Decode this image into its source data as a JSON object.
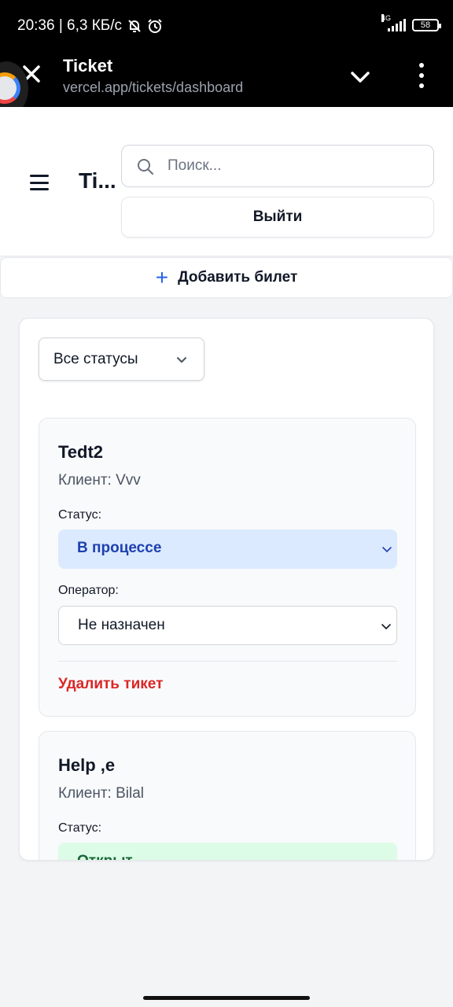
{
  "status_bar": {
    "time_speed": "20:36 | 6,3 КБ/с",
    "network": "4G",
    "battery": "58"
  },
  "browser": {
    "title": "Ticket",
    "url": "vercel.app/tickets/dashboard",
    "icons": [
      "close-icon",
      "chevron-down-icon",
      "more-vert-icon"
    ]
  },
  "header": {
    "app_title": "Ti...",
    "search_placeholder": "Поиск...",
    "logout_label": "Выйти"
  },
  "toolbar": {
    "add_ticket_label": "Добавить билет"
  },
  "filter": {
    "selected": "Все статусы"
  },
  "colors": {
    "in_progress_bg": "#dbeafe",
    "in_progress_text": "#1e40af",
    "open_bg": "#dcfce7",
    "open_text": "#166534",
    "delete": "#dc2626",
    "accent": "#2563eb"
  },
  "tickets": [
    {
      "title": "Tedt2",
      "client": "Клиент: Vvv",
      "status_label": "Статус:",
      "status": "В процессе",
      "operator_label": "Оператор:",
      "operator": "Не назначен",
      "delete_label": "Удалить тикет"
    },
    {
      "title": "Help ,e",
      "client": "Клиент: Bilal",
      "status_label": "Статус:",
      "status": "Открыт"
    }
  ]
}
